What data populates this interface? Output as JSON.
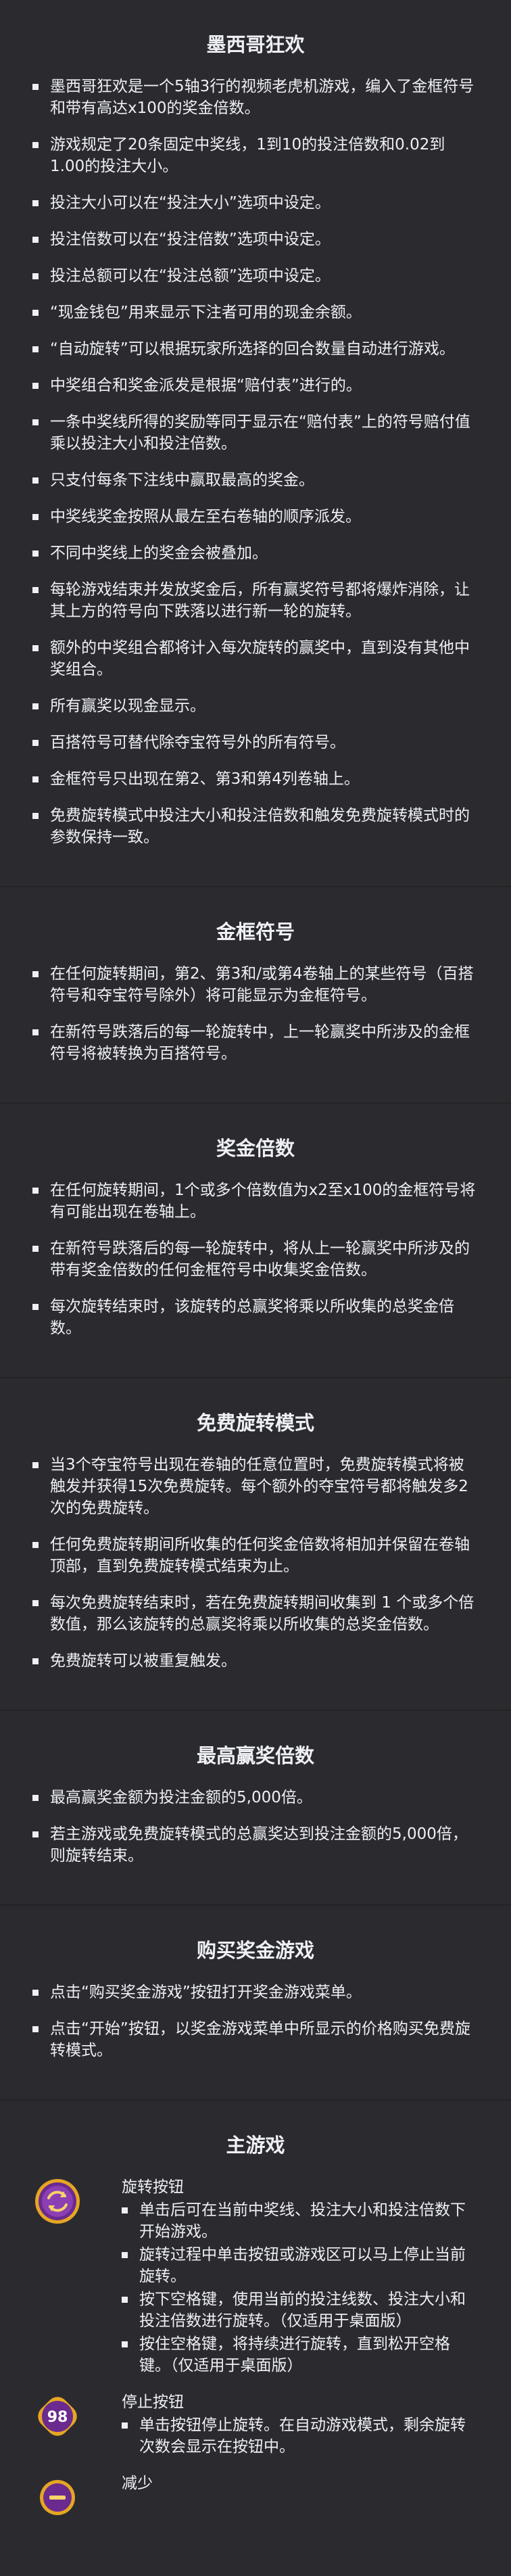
{
  "sections": [
    {
      "title": "墨西哥狂欢",
      "items": [
        "墨西哥狂欢是一个5轴3行的视频老虎机游戏，编入了金框符号和带有高达x100的奖金倍数。",
        "游戏规定了20条固定中奖线，1到10的投注倍数和0.02到1.00的投注大小。",
        "投注大小可以在“投注大小”选项中设定。",
        "投注倍数可以在“投注倍数”选项中设定。",
        "投注总额可以在“投注总额”选项中设定。",
        "“现金钱包”用来显示下注者可用的现金余额。",
        "“自动旋转”可以根据玩家所选择的回合数量自动进行游戏。",
        "中奖组合和奖金派发是根据“赔付表”进行的。",
        "一条中奖线所得的奖励等同于显示在“赔付表”上的符号赔付值乘以投注大小和投注倍数。",
        "只支付每条下注线中赢取最高的奖金。",
        "中奖线奖金按照从最左至右卷轴的顺序派发。",
        "不同中奖线上的奖金会被叠加。",
        "每轮游戏结束并发放奖金后，所有赢奖符号都将爆炸消除，让其上方的符号向下跌落以进行新一轮的旋转。",
        "额外的中奖组合都将计入每次旋转的赢奖中，直到没有其他中奖组合。",
        "所有赢奖以现金显示。",
        "百搭符号可替代除夺宝符号外的所有符号。",
        "金框符号只出现在第2、第3和第4列卷轴上。",
        "免费旋转模式中投注大小和投注倍数和触发免费旋转模式时的参数保持一致。"
      ]
    },
    {
      "title": "金框符号",
      "items": [
        "在任何旋转期间，第2、第3和/或第4卷轴上的某些符号（百搭符号和夺宝符号除外）将可能显示为金框符号。",
        "在新符号跌落后的每一轮旋转中，上一轮赢奖中所涉及的金框符号将被转换为百搭符号。"
      ]
    },
    {
      "title": "奖金倍数",
      "items": [
        "在任何旋转期间，1个或多个倍数值为x2至x100的金框符号将有可能出现在卷轴上。",
        "在新符号跌落后的每一轮旋转中，将从上一轮赢奖中所涉及的带有奖金倍数的任何金框符号中收集奖金倍数。",
        "每次旋转结束时，该旋转的总赢奖将乘以所收集的总奖金倍数。"
      ]
    },
    {
      "title": "免费旋转模式",
      "items": [
        "当3个夺宝符号出现在卷轴的任意位置时，免费旋转模式将被触发并获得15次免费旋转。每个额外的夺宝符号都将触发多2次的免费旋转。",
        "任何免费旋转期间所收集的任何奖金倍数将相加并保留在卷轴顶部，直到免费旋转模式结束为止。",
        "每次免费旋转结束时，若在免费旋转期间收集到 1 个或多个倍数值，那么该旋转的总赢奖将乘以所收集的总奖金倍数。",
        "免费旋转可以被重复触发。"
      ]
    },
    {
      "title": "最高赢奖倍数",
      "items": [
        "最高赢奖金额为投注金额的5,000倍。",
        "若主游戏或免费旋转模式的总赢奖达到投注金额的5,000倍，则旋转结束。"
      ]
    },
    {
      "title": "购买奖金游戏",
      "items": [
        "点击“购买奖金游戏”按钮打开奖金游戏菜单。",
        "点击“开始”按钮，以奖金游戏菜单中所显示的价格购买免费旋转模式。"
      ]
    }
  ],
  "main_game": {
    "title": "主游戏",
    "buttons": [
      {
        "name": "旋转按钮",
        "icon": "spin-icon",
        "items": [
          "单击后可在当前中奖线、投注大小和投注倍数下开始游戏。",
          "旋转过程中单击按钮或游戏区可以马上停止当前旋转。",
          "按下空格键，使用当前的投注线数、投注大小和投注倍数进行旋转。（仅适用于桌面版）",
          "按住空格键，将持续进行旋转，直到松开空格键。（仅适用于桌面版）"
        ]
      },
      {
        "name": "停止按钮",
        "icon": "stop-icon",
        "icon_text": "98",
        "items": [
          "单击按钮停止旋转。在自动游戏模式，剩余旋转次数会显示在按钮中。"
        ]
      },
      {
        "name": "减少",
        "icon": "decrease-icon",
        "items": []
      }
    ]
  },
  "colors": {
    "background": "#2b2b2f",
    "text": "#eef0f4",
    "button_purple": "#6a2a8e",
    "button_gold": "#e6a623"
  }
}
